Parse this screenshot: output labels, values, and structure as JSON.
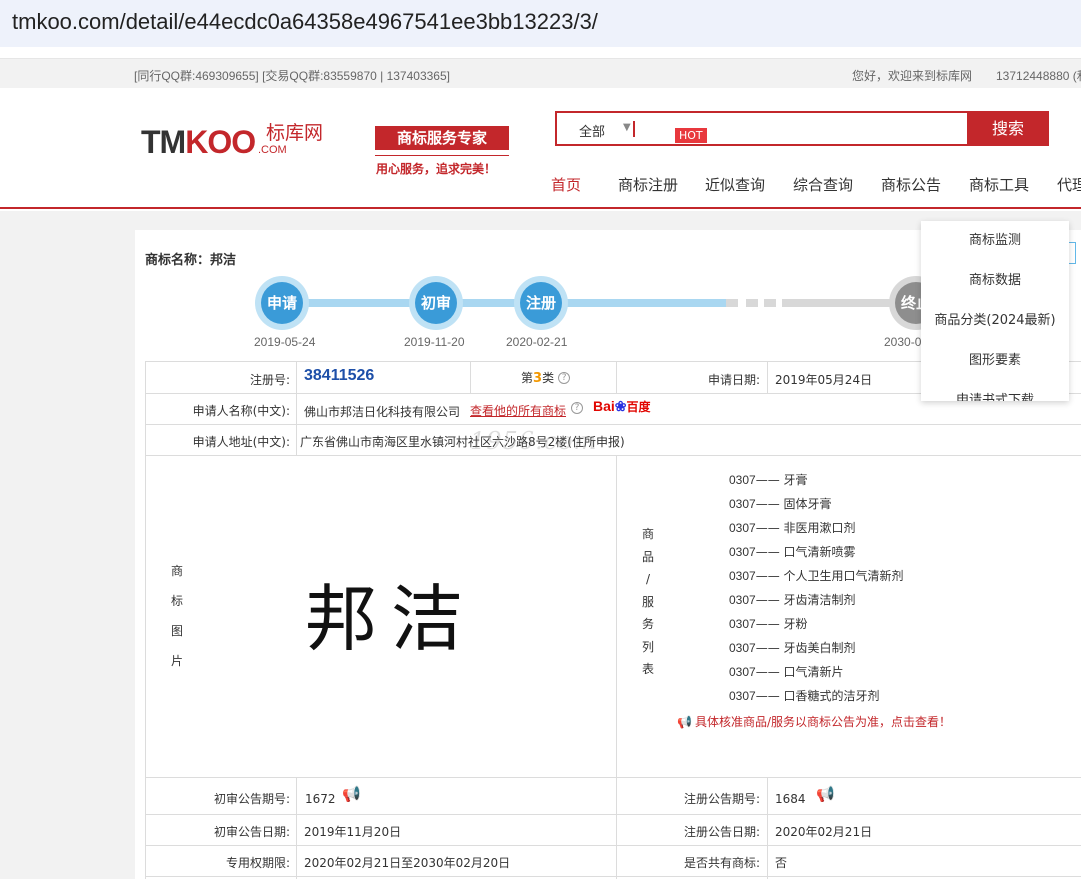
{
  "browser": {
    "url": "tmkoo.com/detail/e44ecdc0a64358e4967541ee3bb13223/3/"
  },
  "topbar": {
    "qq_groups": "[同行QQ群:469309655] [交易QQ群:83559870 | 137403365]",
    "welcome": "您好，欢迎来到标库网",
    "phone": "13712448880 (和"
  },
  "header": {
    "logo_tm": "TM",
    "logo_koo": "KOO",
    "logo_com": ".COM",
    "logo_cn": "标库网",
    "slogan": "商标服务专家",
    "slogan_sub": "用心服务，追求完美！"
  },
  "search": {
    "scope": "全部",
    "hot": "HOT",
    "button": "搜索",
    "value": ""
  },
  "nav": [
    "首页",
    "商标注册",
    "近似查询",
    "综合查询",
    "商标公告",
    "商标工具",
    "代理"
  ],
  "dropdown": [
    "商标监测",
    "商标数据",
    "商品分类(2024最新)",
    "图形要素",
    "申请书式下载"
  ],
  "trademark": {
    "name_label": "商标名称：",
    "name": "邦洁",
    "timeline": [
      {
        "label": "申请",
        "date": "2019-05-24"
      },
      {
        "label": "初审",
        "date": "2019-11-20"
      },
      {
        "label": "注册",
        "date": "2020-02-21"
      },
      {
        "label": "终止",
        "date": "2030-0"
      }
    ],
    "reg_no_label": "注册号:",
    "reg_no": "38411526",
    "class_prefix": "第",
    "class_no": "3",
    "class_suffix": "类",
    "apply_date_label": "申请日期:",
    "apply_date": "2019年05月24日",
    "applicant_label": "申请人名称(中文):",
    "applicant": "佛山市邦洁日化科技有限公司",
    "applicant_link": "查看他的所有商标",
    "baidu_bai": "Bai",
    "baidu_du": "百度",
    "address_label": "申请人地址(中文):",
    "address": "广东省佛山市南海区里水镇河村社区六沙路8号2楼(住所申报)",
    "watermark": "1956.com",
    "image_label": [
      "商",
      "标",
      "图",
      "片"
    ],
    "image_text": "邦洁",
    "goods_label": [
      "商",
      "品",
      "/",
      "服",
      "务",
      "列",
      "表"
    ],
    "goods": [
      {
        "code": "0307",
        "name": "牙膏"
      },
      {
        "code": "0307",
        "name": "固体牙膏"
      },
      {
        "code": "0307",
        "name": "非医用漱口剂"
      },
      {
        "code": "0307",
        "name": "口气清新喷雾"
      },
      {
        "code": "0307",
        "name": "个人卫生用口气清新剂"
      },
      {
        "code": "0307",
        "name": "牙齿清洁制剂"
      },
      {
        "code": "0307",
        "name": "牙粉"
      },
      {
        "code": "0307",
        "name": "牙齿美白制剂"
      },
      {
        "code": "0307",
        "name": "口气清新片"
      },
      {
        "code": "0307",
        "name": "口香糖式的洁牙剂"
      }
    ],
    "goods_dash": "——",
    "goods_note": "具体核准商品/服务以商标公告为准，点击查看！",
    "prelim_issue_label": "初审公告期号:",
    "prelim_issue": "1672",
    "reg_issue_label": "注册公告期号:",
    "reg_issue": "1684",
    "prelim_date_label": "初审公告日期:",
    "prelim_date": "2019年11月20日",
    "reg_date_label": "注册公告日期:",
    "reg_date": "2020年02月21日",
    "term_label": "专用权期限:",
    "term": "2020年02月21日至2030年02月20日",
    "shared_label": "是否共有商标:",
    "shared": "否"
  },
  "colors": {
    "brand_red": "#c3272b",
    "timeline_blue": "#3a9bd8",
    "reg_no_blue": "#1d4fa8",
    "class_orange": "#f39800"
  }
}
